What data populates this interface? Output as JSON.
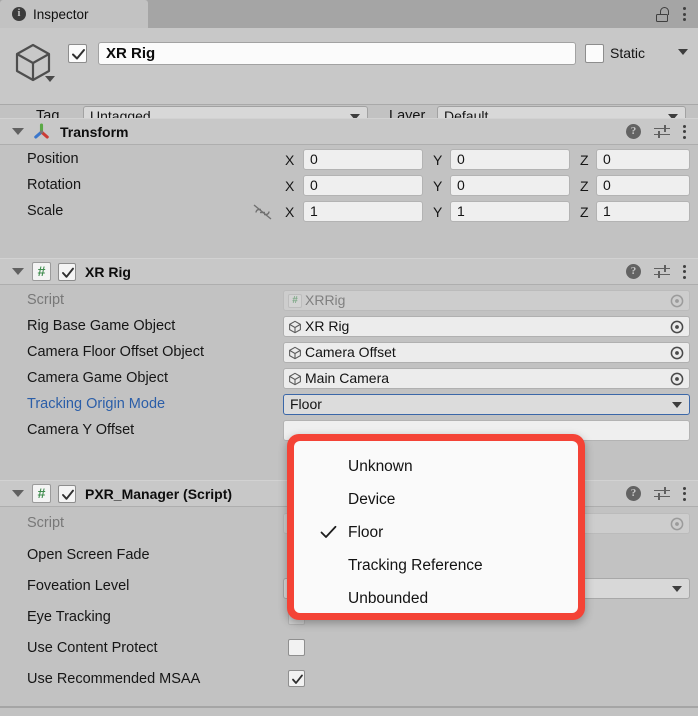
{
  "window": {
    "tab_label": "Inspector",
    "tab_icon": "info-icon",
    "lock_icon": "lock-open-icon",
    "menu_icon": "kebab-menu-icon"
  },
  "gameobject": {
    "icon": "cube-icon",
    "enabled": true,
    "name": "XR Rig",
    "static_label": "Static",
    "static_checked": false,
    "tag_label": "Tag",
    "tag_value": "Untagged",
    "layer_label": "Layer",
    "layer_value": "Default"
  },
  "components": [
    {
      "title": "Transform",
      "icon": "transform-gizmo-icon",
      "has_enable_toggle": false,
      "rows": [
        {
          "label": "Position",
          "type": "vector3",
          "x": "0",
          "y": "0",
          "z": "0"
        },
        {
          "label": "Rotation",
          "type": "vector3",
          "x": "0",
          "y": "0",
          "z": "0"
        },
        {
          "label": "Scale",
          "type": "vector3",
          "x": "1",
          "y": "1",
          "z": "1",
          "constrain_icon": "constrain-proportions-off-icon"
        }
      ]
    },
    {
      "title": "XR Rig",
      "icon": "csharp-script-icon",
      "has_enable_toggle": true,
      "enabled": true,
      "rows": [
        {
          "label": "Script",
          "type": "object",
          "value": "XRRig",
          "icon": "csharp-script-icon",
          "disabled": true
        },
        {
          "label": "Rig Base Game Object",
          "type": "object",
          "value": "XR Rig",
          "icon": "cube-icon"
        },
        {
          "label": "Camera Floor Offset Object",
          "type": "object",
          "value": "Camera Offset",
          "icon": "cube-icon"
        },
        {
          "label": "Camera Game Object",
          "type": "object",
          "value": "Main Camera",
          "icon": "cube-icon"
        },
        {
          "label": "Tracking Origin Mode",
          "type": "dropdown",
          "value": "Floor",
          "highlighted": true,
          "focused": true
        },
        {
          "label": "Camera Y Offset",
          "type": "number",
          "value": ""
        }
      ]
    },
    {
      "title": "PXR_Manager (Script)",
      "icon": "csharp-script-icon",
      "has_enable_toggle": true,
      "enabled": true,
      "rows": [
        {
          "label": "Script",
          "type": "object",
          "value": "",
          "disabled": true
        },
        {
          "label": "Open Screen Fade",
          "type": "checkbox",
          "checked": false
        },
        {
          "label": "Foveation Level",
          "type": "dropdown",
          "value": ""
        },
        {
          "label": "Eye Tracking",
          "type": "checkbox",
          "checked": false,
          "dimmed": true
        },
        {
          "label": "Use Content Protect",
          "type": "checkbox",
          "checked": false
        },
        {
          "label": "Use Recommended MSAA",
          "type": "checkbox",
          "checked": true
        }
      ]
    }
  ],
  "dropdown_popup": {
    "highlight_color": "#f44336",
    "selected": "Floor",
    "options": [
      {
        "label": "Unknown",
        "checked": false
      },
      {
        "label": "Device",
        "checked": false
      },
      {
        "label": "Floor",
        "checked": true
      },
      {
        "label": "Tracking Reference",
        "checked": false
      },
      {
        "label": "Unbounded",
        "checked": false
      }
    ]
  },
  "axes": {
    "x": "X",
    "y": "Y",
    "z": "Z"
  }
}
